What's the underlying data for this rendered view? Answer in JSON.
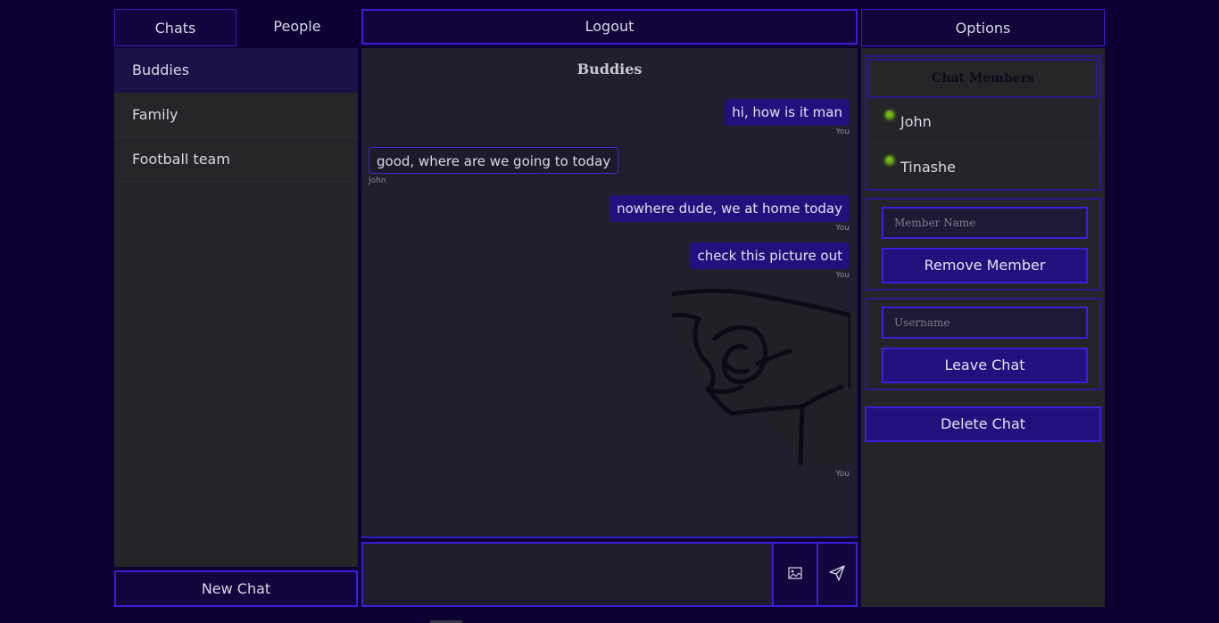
{
  "sidebar": {
    "tabs": {
      "chats": "Chats",
      "people": "People"
    },
    "chats": [
      {
        "name": "Buddies",
        "active": true
      },
      {
        "name": "Family",
        "active": false
      },
      {
        "name": "Football team",
        "active": false
      }
    ],
    "new_chat_label": "New Chat"
  },
  "header": {
    "logout_label": "Logout",
    "options_label": "Options"
  },
  "conversation": {
    "title": "Buddies",
    "messages": [
      {
        "text": "hi, how is it man",
        "sender": "You"
      },
      {
        "text": "good, where are we going to today",
        "sender": "John"
      },
      {
        "text": "nowhere dude, we at home today",
        "sender": "You"
      },
      {
        "text": "check this picture out",
        "sender": "You"
      },
      {
        "text": "",
        "sender": "You",
        "attachment": "hand-ok-gesture-image"
      }
    ]
  },
  "composer": {
    "value": "",
    "image_icon": "image-icon",
    "send_icon": "send-icon"
  },
  "options": {
    "members_heading": "Chat Members",
    "members": [
      {
        "name": "John",
        "online": true
      },
      {
        "name": "Tinashe",
        "online": true
      }
    ],
    "remove_placeholder": "Member Name",
    "remove_label": "Remove Member",
    "leave_placeholder": "Username",
    "leave_label": "Leave Chat",
    "delete_label": "Delete Chat"
  },
  "colors": {
    "background": "#0d0033",
    "accent_border": "#3a1fd6",
    "button_fill": "#24107d",
    "panel": "#252429",
    "online": "#7fd01c"
  }
}
